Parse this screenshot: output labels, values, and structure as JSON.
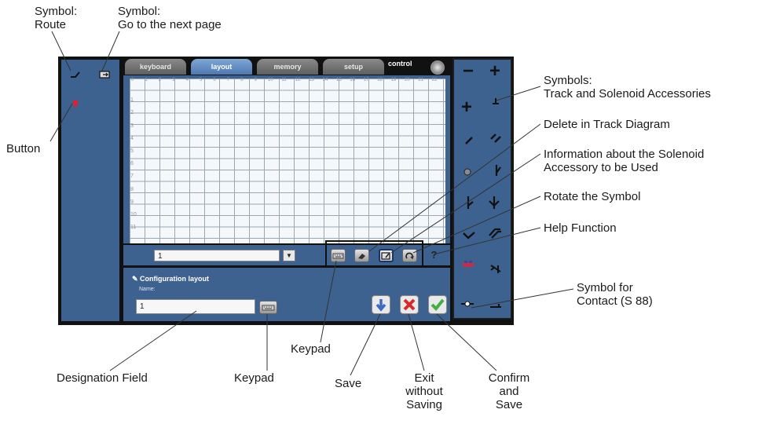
{
  "tabs": [
    "keyboard",
    "layout",
    "memory",
    "setup"
  ],
  "control_label": "control",
  "grid": {
    "columns": [
      "0",
      "1",
      "2",
      "3",
      "4",
      "5",
      "6",
      "7",
      "8",
      "9",
      "10",
      "11",
      "12",
      "13",
      "14",
      "15",
      "16",
      "17",
      "18",
      "19",
      "20",
      "21",
      "22"
    ],
    "rows": [
      "0",
      "1",
      "2",
      "3",
      "4",
      "5",
      "6",
      "7",
      "8",
      "9",
      "10",
      "11"
    ]
  },
  "page_selector_value": "1",
  "config": {
    "title": "Configuration layout",
    "name_label": "Name:",
    "name_value": "1"
  },
  "colors": {
    "panel": "#3e628f",
    "frame": "#111111",
    "save": "#3b6bc4",
    "exit": "#d62a2a",
    "confirm": "#43b043"
  },
  "captions": {
    "symbol_route": [
      "Symbol:",
      "Route"
    ],
    "symbol_next_page": [
      "Symbol:",
      "Go to the next page"
    ],
    "button": "Button",
    "symbols_track": [
      "Symbols:",
      "Track and Solenoid Accessories"
    ],
    "delete": "Delete in Track Diagram",
    "info": [
      "Information about the Solenoid",
      "Accessory to be Used"
    ],
    "rotate": "Rotate the Symbol",
    "help": "Help Function",
    "contact": [
      "Symbol for",
      "Contact (S 88)"
    ],
    "keypad_upper": "Keypad",
    "keypad_lower": "Keypad",
    "designation": "Designation Field",
    "save": "Save",
    "exit": [
      "Exit",
      "without",
      "Saving"
    ],
    "confirm": [
      "Confirm",
      "and",
      "Save"
    ]
  }
}
